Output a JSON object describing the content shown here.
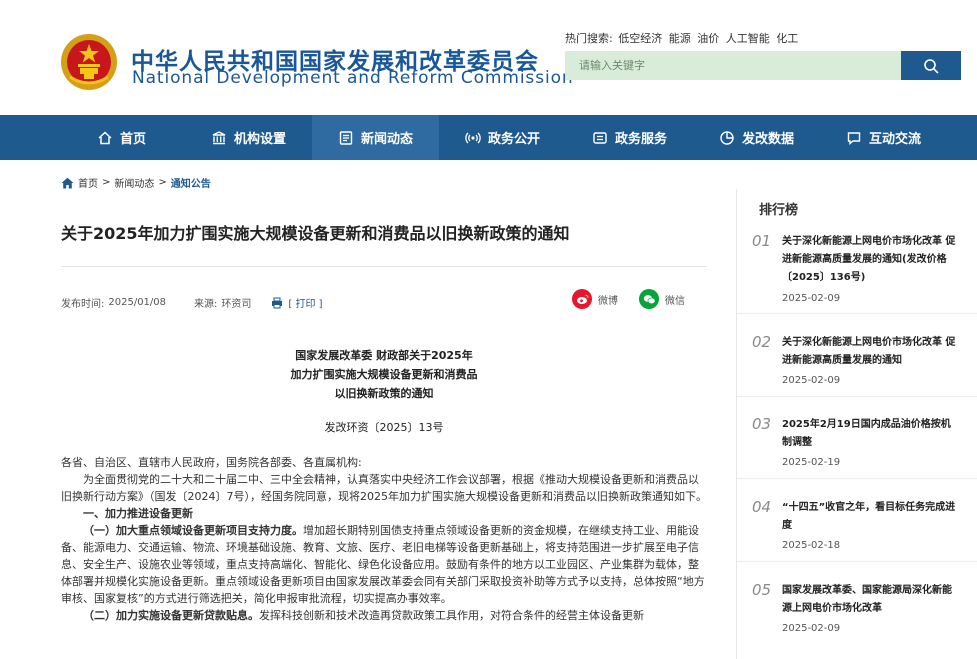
{
  "header": {
    "site_cn": "中华人民共和国国家发展和改革委员会",
    "site_en": "National Development and Reform Commission",
    "hot_label": "热门搜索:",
    "hot_terms": [
      "低空经济",
      "能源",
      "油价",
      "人工智能",
      "化工"
    ],
    "search_placeholder": "请输入关键字"
  },
  "nav": [
    {
      "label": "首页",
      "icon": "home-icon"
    },
    {
      "label": "机构设置",
      "icon": "institution-icon"
    },
    {
      "label": "新闻动态",
      "icon": "news-icon"
    },
    {
      "label": "政务公开",
      "icon": "broadcast-icon"
    },
    {
      "label": "政务服务",
      "icon": "service-icon"
    },
    {
      "label": "发改数据",
      "icon": "pie-chart-icon"
    },
    {
      "label": "互动交流",
      "icon": "chat-icon"
    }
  ],
  "breadcrumb": [
    "首页",
    "新闻动态",
    "通知公告"
  ],
  "article": {
    "title": "关于2025年加力扩围实施大规模设备更新和消费品以旧换新政策的通知",
    "publish_label": "发布时间:",
    "publish_date": "2025/01/08",
    "source_label": "来源:",
    "source": "环资司",
    "print_label": "[ 打印 ]",
    "share_weibo": "微博",
    "share_wechat": "微信",
    "doc_head_lines": [
      "国家发展改革委 财政部关于2025年",
      "加力扩围实施大规模设备更新和消费品",
      "以旧换新政策的通知"
    ],
    "doc_no": "发改环资〔2025〕13号",
    "addressee": "各省、自治区、直辖市人民政府，国务院各部委、各直属机构:",
    "para1": "为全面贯彻党的二十大和二十届二中、三中全会精神，认真落实中央经济工作会议部署，根据《推动大规模设备更新和消费品以旧换新行动方案》（国发〔2024〕7号），经国务院同意，现将2025年加力扩围实施大规模设备更新和消费品以旧换新政策通知如下。",
    "section1": "一、加力推进设备更新",
    "sub1_head": "（一）加大重点领域设备更新项目支持力度。",
    "sub1_body": "增加超长期特别国债支持重点领域设备更新的资金规模，在继续支持工业、用能设备、能源电力、交通运输、物流、环境基础设施、教育、文旅、医疗、老旧电梯等设备更新基础上，将支持范围进一步扩展至电子信息、安全生产、设施农业等领域，重点支持高端化、智能化、绿色化设备应用。鼓励有条件的地方以工业园区、产业集群为载体，整体部署并规模化实施设备更新。重点领域设备更新项目由国家发展改革委会同有关部门采取投资补助等方式予以支持，总体按照“地方审核、国家复核”的方式进行筛选把关，简化申报审批流程，切实提高办事效率。",
    "sub2_head": "（二）加力实施设备更新贷款贴息。",
    "sub2_body": "发挥科技创新和技术改造再贷款政策工具作用，对符合条件的经营主体设备更新"
  },
  "sidebar": {
    "title": "排行榜",
    "items": [
      {
        "num": "01",
        "text": "关于深化新能源上网电价市场化改革 促进新能源高质量发展的通知(发改价格〔2025〕136号)",
        "date": "2025-02-09"
      },
      {
        "num": "02",
        "text": "关于深化新能源上网电价市场化改革 促进新能源高质量发展的通知",
        "date": "2025-02-09"
      },
      {
        "num": "03",
        "text": "2025年2月19日国内成品油价格按机制调整",
        "date": "2025-02-19"
      },
      {
        "num": "04",
        "text": "“十四五”收官之年，看目标任务完成进度",
        "date": "2025-02-18"
      },
      {
        "num": "05",
        "text": "国家发展改革委、国家能源局深化新能源上网电价市场化改革",
        "date": "2025-02-09"
      }
    ]
  },
  "colors": {
    "brand": "#1f5a8f",
    "nav_active": "#2f6aa0",
    "search_bg": "#d9ecd9",
    "weibo": "#e6162d",
    "wechat": "#07a43a"
  }
}
